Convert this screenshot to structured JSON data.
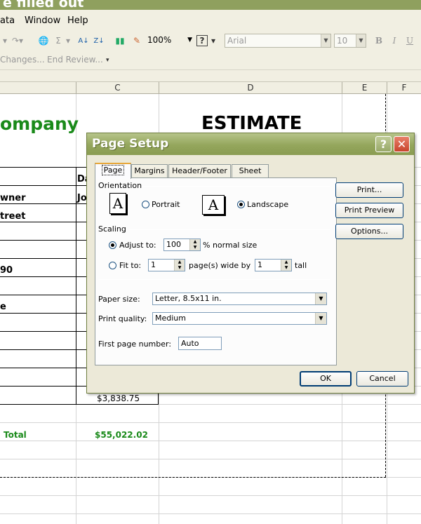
{
  "window": {
    "title_partial": "e filled out"
  },
  "menu": {
    "items": [
      "ata",
      "Window",
      "Help"
    ]
  },
  "toolbar": {
    "zoom": "100%",
    "font": "Arial",
    "font_size": "10",
    "bold": "B",
    "italic": "I",
    "underline": "U",
    "sum_glyph": "Σ",
    "help_glyph": "?"
  },
  "review": {
    "changes": "Changes...",
    "end_review": "End Review..."
  },
  "columns": [
    "C",
    "D",
    "E",
    "F"
  ],
  "sheet": {
    "company_partial": "ompany",
    "estimate": "ESTIMATE",
    "date_partial": "Da",
    "owner_partial": "wner",
    "owner_value_partial": "Jo",
    "street_partial": "treet",
    "zip_partial": "90",
    "e_partial": "e",
    "subtotal_value": "$3,838.75",
    "total_label": "Total",
    "total_value": "$55,022.02"
  },
  "dialog": {
    "title": "Page Setup",
    "tabs": [
      "Page",
      "Margins",
      "Header/Footer",
      "Sheet"
    ],
    "active_tab": "Page",
    "orientation": {
      "label": "Orientation",
      "portrait": "Portrait",
      "landscape": "Landscape",
      "selected": "Landscape"
    },
    "scaling": {
      "label": "Scaling",
      "adjust_to": "Adjust to:",
      "adjust_value": "100",
      "normal_size": "% normal size",
      "fit_to": "Fit to:",
      "fit_wide": "1",
      "wide_by": "page(s) wide by",
      "fit_tall": "1",
      "tall": "tall",
      "selected": "adjust"
    },
    "paper_size": {
      "label": "Paper size:",
      "value": "Letter, 8.5x11 in."
    },
    "print_quality": {
      "label": "Print quality:",
      "value": "Medium"
    },
    "first_page_number": {
      "label": "First page number:",
      "value": "Auto"
    },
    "buttons": {
      "print": "Print...",
      "print_preview": "Print Preview",
      "options": "Options...",
      "ok": "OK",
      "cancel": "Cancel"
    }
  }
}
